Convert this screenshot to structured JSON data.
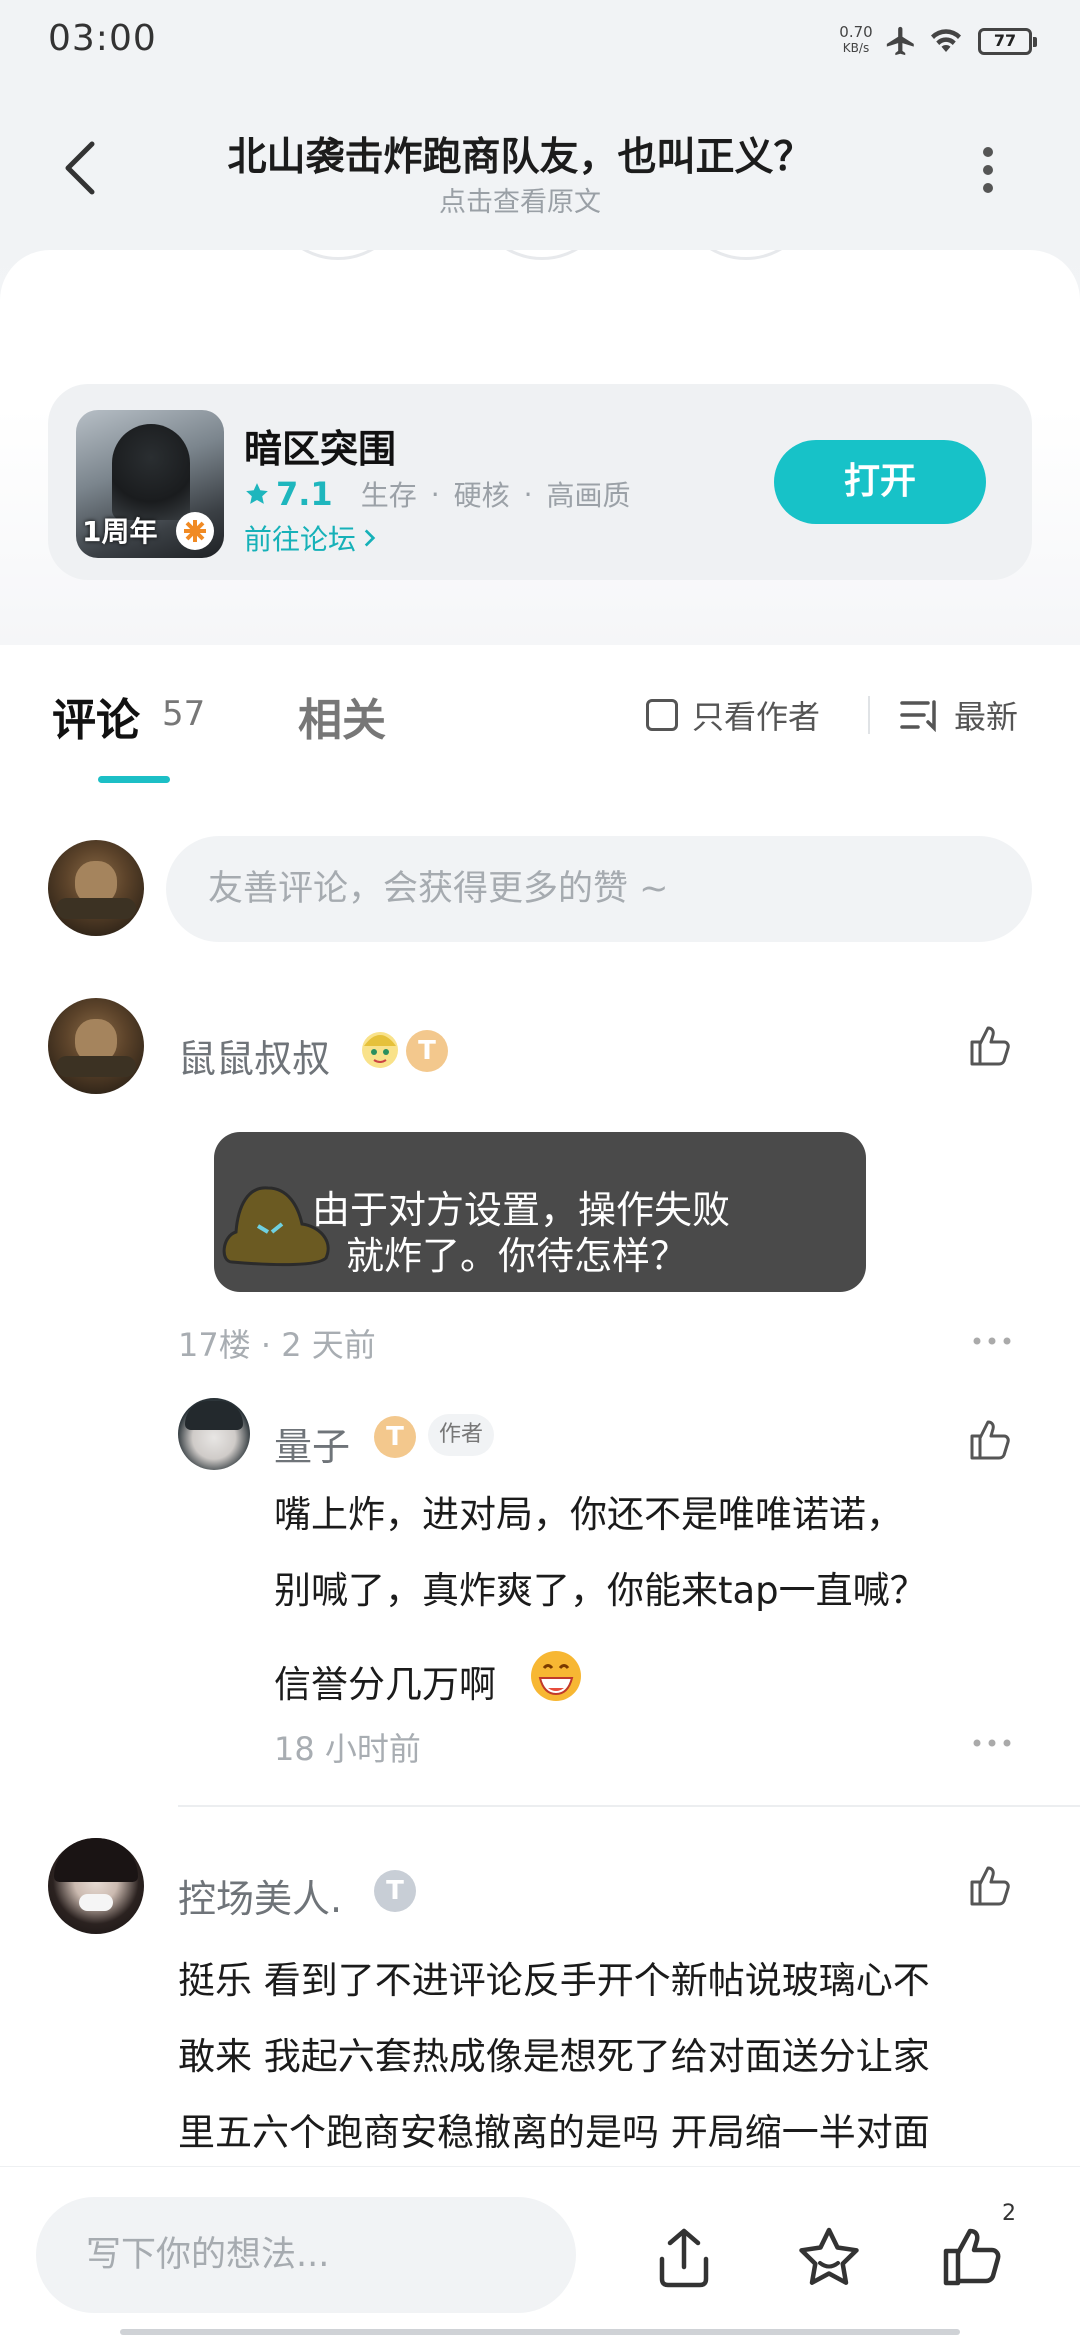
{
  "status_bar": {
    "time": "03:00",
    "net_speed": "0.70",
    "net_unit": "KB/s",
    "battery": "77"
  },
  "header": {
    "title": "北山袭击炸跑商队友，也叫正义？",
    "subtitle": "点击查看原文"
  },
  "game": {
    "name": "暗区突围",
    "icon_badge": "1周年",
    "score": "7.1",
    "tags": [
      "生存",
      "硬核",
      "高画质"
    ],
    "forum_link": "前往论坛",
    "open_label": "打开"
  },
  "tabs": {
    "comments_label": "评论",
    "comments_count": "57",
    "related_label": "相关",
    "only_author": "只看作者",
    "sort_label": "最新"
  },
  "comment_input": {
    "placeholder": "友善评论，会获得更多的赞 ~"
  },
  "comments": [
    {
      "username": "鼠鼠叔叔",
      "level": "T",
      "floor_time": "17楼 · 2 天前",
      "toast_line1": "由于对方设置，操作失败",
      "toast_line2": "就炸了。你待怎样？",
      "reply": {
        "username": "量子",
        "level": "T",
        "author_tag": "作者",
        "line1": "嘴上炸，进对局，你还不是唯唯诺诺，",
        "line2": "别喊了，真炸爽了，你能来tap一直喊？",
        "line3": "信誉分几万啊",
        "time": "18 小时前"
      }
    },
    {
      "username": "控场美人.",
      "level": "T",
      "line1": "挺乐 看到了不进评论反手开个新帖说玻璃心不",
      "line2": "敢来 我起六套热成像是想死了给对面送分让家",
      "line3": "里五六个跑商安稳撤离的是吗 开局缩一半对面"
    }
  ],
  "bottom_bar": {
    "placeholder": "写下你的想法...",
    "like_count": "2"
  },
  "colors": {
    "accent": "#17c2c8",
    "toast_bg": "#4a4a4a"
  }
}
